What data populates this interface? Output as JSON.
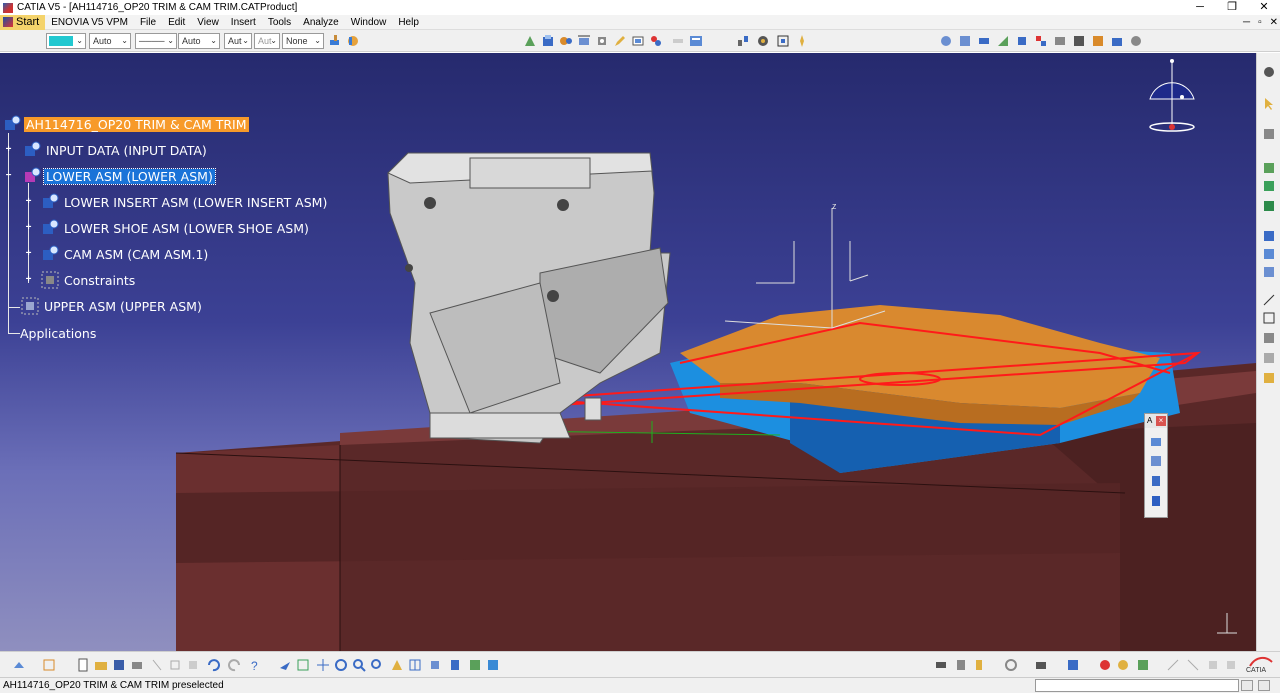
{
  "window": {
    "title": "CATIA V5 - [AH114716_OP20 TRIM & CAM TRIM.CATProduct]",
    "controls": {
      "minimize": "─",
      "restore": "❐",
      "close": "✕"
    }
  },
  "menubar": {
    "start": "Start",
    "items": [
      "ENOVIA V5 VPM",
      "File",
      "Edit",
      "View",
      "Insert",
      "Tools",
      "Analyze",
      "Window",
      "Help"
    ],
    "doc_controls": {
      "minimize": "─",
      "restore": "▫",
      "close": "✕"
    }
  },
  "graphic_properties": {
    "color_swatch": "#22c8d0",
    "transparency": "Auto",
    "linetype": "────",
    "thickness": "Auto",
    "layer_a": "Aut",
    "layer_b": "Aut",
    "filter": "None"
  },
  "tree": {
    "root": "AH114716_OP20 TRIM & CAM TRIM",
    "nodes": [
      {
        "label": "INPUT DATA (INPUT DATA)"
      },
      {
        "label": "LOWER ASM (LOWER ASM)"
      },
      {
        "label": "LOWER INSERT ASM (LOWER INSERT ASM)"
      },
      {
        "label": "LOWER SHOE ASM (LOWER SHOE ASM)"
      },
      {
        "label": "CAM ASM (CAM ASM.1)"
      },
      {
        "label": "Constraints"
      },
      {
        "label": "UPPER ASM (UPPER ASM)"
      },
      {
        "label": "Applications"
      }
    ]
  },
  "compass": {
    "axis_label": "z"
  },
  "floating_toolbar": {
    "head": "A",
    "close": "×"
  },
  "status": {
    "text": "AH114716_OP20 TRIM & CAM TRIM preselected",
    "command_input": ""
  },
  "catia_logo": "CATIA",
  "colors": {
    "background_top": "#262a6e",
    "background_bottom": "#8f8fbf",
    "die_brown": "#5e2a2a",
    "part_orange": "#d9892f",
    "part_blue": "#1c8fe0",
    "selection_red": "#ff1a1a",
    "cam_gray": "#c8c8c8",
    "tree_selected": "#1a73d8",
    "tree_root": "#f79a2a"
  }
}
